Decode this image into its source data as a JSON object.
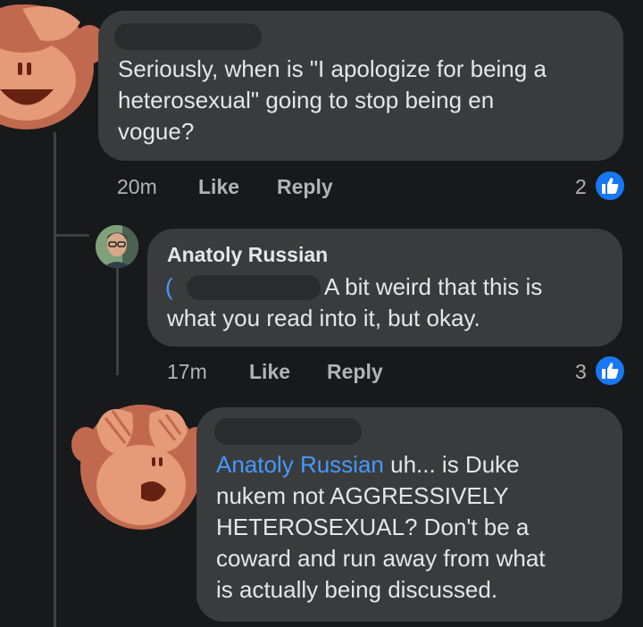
{
  "comments": [
    {
      "text_lines": [
        "Seriously, when is \"I apologize for being a",
        "heterosexual\" going to stop being en",
        "vogue?"
      ],
      "time": "20m",
      "like_label": "Like",
      "reply_label": "Reply",
      "reaction_count": "2",
      "avatar_icon": "see-no-evil-monkey-icon"
    },
    {
      "author": "Anatoly Russian",
      "mention_prefix": "(",
      "text_line1": "A bit weird that this is",
      "text_line2": "what you read into it, but okay.",
      "time": "17m",
      "like_label": "Like",
      "reply_label": "Reply",
      "reaction_count": "3",
      "avatar_icon": "profile-photo"
    },
    {
      "mention": "Anatoly Russian",
      "text_line1": " uh... is Duke",
      "text_lines": [
        "nukem not AGGRESSIVELY",
        "HETEROSEXUAL?  Don't be a",
        "coward and run away from what",
        "is actually being discussed."
      ],
      "avatar_icon": "see-no-evil-monkey-icon"
    }
  ],
  "colors": {
    "background": "#18191a",
    "bubble": "#3a3b3c",
    "mention": "#4599ff",
    "like_badge": "#1877f2"
  }
}
